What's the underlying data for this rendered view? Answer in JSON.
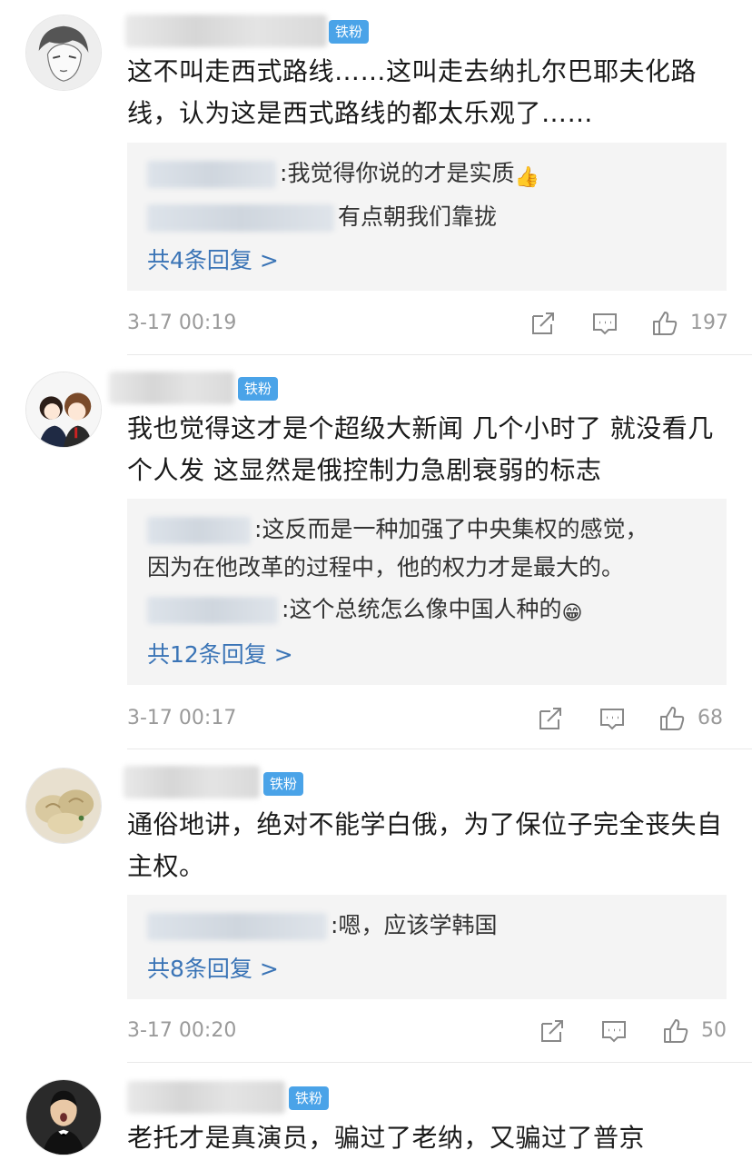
{
  "colors": {
    "badge": "#4aa3e8",
    "link": "#3a74b6",
    "meta": "#9a9a9a",
    "reply_bg": "#f4f4f4"
  },
  "comments": [
    {
      "badge": "铁粉",
      "avatar": "manga-man-avatar",
      "text": "这不叫走西式路线……这叫走去纳扎尔巴耶夫化路线，认为这是西式路线的都太乐观了……",
      "replies": [
        {
          "sep": ":",
          "text": "我觉得你说的才是实质",
          "emoji": "👍"
        },
        {
          "sep": "",
          "text": "有点朝我们靠拢"
        }
      ],
      "more": "共4条回复 >",
      "time": "3-17 00:19",
      "likes": "197"
    },
    {
      "badge": "铁粉",
      "avatar": "couple-cartoon-avatar",
      "text": "我也觉得这才是个超级大新闻 几个小时了 就没看几个人发 这显然是俄控制力急剧衰弱的标志",
      "replies": [
        {
          "sep": ":",
          "text": "这反而是一种加强了中央集权的感觉，",
          "cont": "因为在他改革的过程中，他的权力才是最大的。"
        },
        {
          "sep": ":",
          "text": "这个总统怎么像中国人种的",
          "emoji": "😁"
        }
      ],
      "more": "共12条回复 >",
      "time": "3-17 00:17",
      "likes": "68"
    },
    {
      "badge": "铁粉",
      "avatar": "dumplings-avatar",
      "text": "通俗地讲，绝对不能学白俄，为了保位子完全丧失自主权。",
      "replies": [
        {
          "sep": ":",
          "text": "嗯，应该学韩国"
        }
      ],
      "more": "共8条回复 >",
      "time": "3-17 00:20",
      "likes": "50"
    },
    {
      "badge": "铁粉",
      "avatar": "singer-avatar",
      "text": "老托才是真演员，骗过了老纳，又骗过了普京"
    }
  ]
}
